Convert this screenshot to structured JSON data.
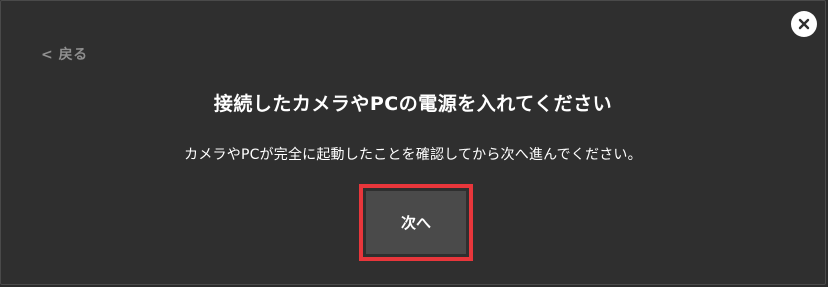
{
  "dialog": {
    "back_label": "< 戻る",
    "title": "接続したカメラやPCの電源を入れてください",
    "description": "カメラやPCが完全に起動したことを確認してから次へ進んでください。",
    "next_label": "次へ",
    "close_icon": "close-icon"
  },
  "colors": {
    "background": "#2f2f2f",
    "button_bg": "#4a4a4a",
    "highlight_border": "#e8363b",
    "text": "#ffffff",
    "muted_text": "#8f8f8f"
  }
}
